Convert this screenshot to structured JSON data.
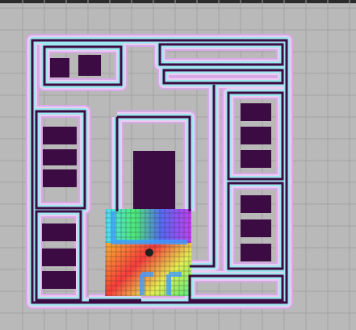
{
  "app": {
    "view": "rviz-map-display"
  },
  "colors": {
    "background": "#b9b9b9",
    "grid": "#a3a3a3",
    "inflation_outer": "#d9a8e8",
    "inflation_mid": "#e9c6f0",
    "inflation_inner": "#9fe7ee",
    "obstacle": "#3d0b44",
    "robot": "#202020",
    "costmap_gradient": [
      "#4b6bff",
      "#47e1ff",
      "#43f07a",
      "#e9f24b",
      "#ff8a2b",
      "#ff3434",
      "#c33bff"
    ]
  },
  "robot": {
    "icon": "robot-marker-icon"
  }
}
